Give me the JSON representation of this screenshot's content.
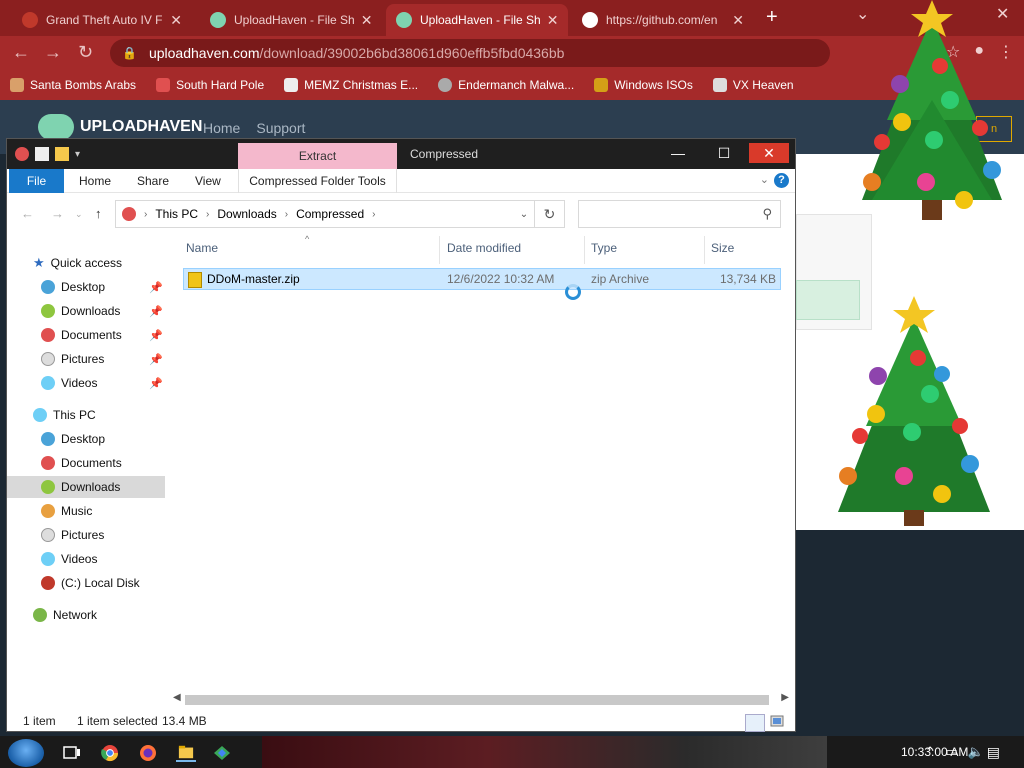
{
  "browser": {
    "tabs": [
      {
        "title": "Grand Theft Auto IV F",
        "active": false
      },
      {
        "title": "UploadHaven - File Sh",
        "active": false
      },
      {
        "title": "UploadHaven - File Sh",
        "active": true
      },
      {
        "title": "https://github.com/en",
        "active": false
      }
    ],
    "url_host": "uploadhaven.com",
    "url_path": "/download/39002b6bd38061d960effb5fbd0436bb",
    "bookmarks": [
      {
        "label": "Santa Bombs Arabs",
        "icon": "bomb-icon"
      },
      {
        "label": "South Hard Pole",
        "icon": "snowflake-icon"
      },
      {
        "label": "MEMZ Christmas E...",
        "icon": "image-icon"
      },
      {
        "label": "Endermanch Malwa...",
        "icon": "raccoon-icon"
      },
      {
        "label": "Windows ISOs",
        "icon": "trophy-icon"
      },
      {
        "label": "VX Heaven",
        "icon": "vx-icon"
      }
    ]
  },
  "site": {
    "logo": "UPLOADHAVEN",
    "nav": [
      "Home",
      "Support"
    ],
    "login": "n"
  },
  "explorer": {
    "window_title": "Compressed",
    "context_tab": "Extract",
    "ribbon_tabs": [
      "File",
      "Home",
      "Share",
      "View"
    ],
    "context_subtab": "Compressed Folder Tools",
    "breadcrumb": [
      "This PC",
      "Downloads",
      "Compressed"
    ],
    "search_placeholder": "",
    "nav": {
      "quick_access": "Quick access",
      "quick_items": [
        "Desktop",
        "Downloads",
        "Documents",
        "Pictures",
        "Videos"
      ],
      "this_pc": "This PC",
      "pc_items": [
        "Desktop",
        "Documents",
        "Downloads",
        "Music",
        "Pictures",
        "Videos",
        "(C:) Local Disk"
      ],
      "network": "Network",
      "selected": "Downloads"
    },
    "columns": [
      "Name",
      "Date modified",
      "Type",
      "Size"
    ],
    "files": [
      {
        "name": "DDoM-master.zip",
        "date": "12/6/2022 10:32 AM",
        "type": "zip Archive",
        "size": "13,734 KB",
        "selected": true
      }
    ],
    "status": {
      "count": "1 item",
      "selection": "1 item selected",
      "size": "13.4 MB"
    }
  },
  "taskbar": {
    "time": "10:33:00 AM",
    "apps": [
      "task-view",
      "chrome",
      "firefox",
      "file-explorer",
      "network-app"
    ]
  },
  "colors": {
    "chrome_frame": "#8b1f1f",
    "chrome_toolbar": "#a52a2a",
    "site_header": "#2c3e50",
    "ribbon_file": "#1979ca",
    "context_tab": "#f4b8cc",
    "selection": "#cce8ff",
    "close_button": "#d93a2a"
  }
}
